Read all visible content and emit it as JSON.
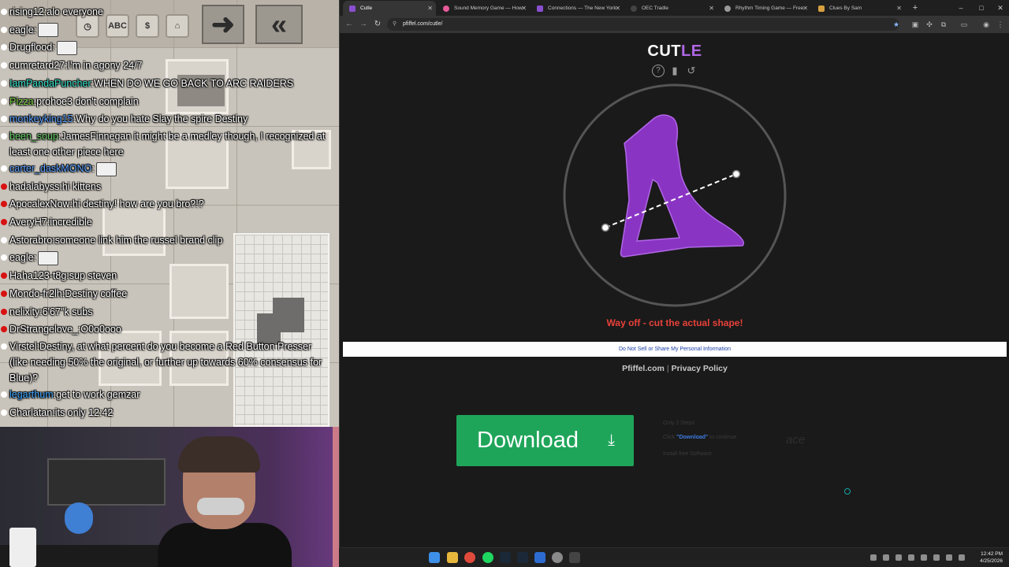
{
  "chat": [
    {
      "user": "rising12",
      "message": "alo everyone",
      "dot": "white",
      "color": "#ffffff"
    },
    {
      "user": "eagle",
      "message": "",
      "dot": "white",
      "color": "#ffffff"
    },
    {
      "user": "Drugflood",
      "message": "",
      "dot": "white",
      "color": "#ffffff"
    },
    {
      "user": "cumretard27",
      "message": "I'm in agony 24/7",
      "dot": "white",
      "color": "#ffffff"
    },
    {
      "user": "IamPandaPuncher",
      "message": "WHEN DO WE GO BACK TO ARC RAIDERS",
      "dot": "white",
      "color": "#35e0c8"
    },
    {
      "user": "Pizza",
      "message": "prohoe3 don't complain",
      "dot": "white",
      "color": "#7fd24a"
    },
    {
      "user": "monkeyking15",
      "message": "Why do you hate Slay the spire Destiny",
      "dot": "white",
      "color": "#5aa0ff"
    },
    {
      "user": "been_soup",
      "message": "JamesFinnegan it might be a medley though, I recognized at least one other piece here",
      "dot": "white",
      "color": "#6ad06a"
    },
    {
      "user": "carter_daskMONO",
      "message": "",
      "dot": "white",
      "color": "#5aa0ff"
    },
    {
      "user": "hadalabyss",
      "message": "hi kittens",
      "dot": "red",
      "color": "#ffffff"
    },
    {
      "user": "ApocalexNow",
      "message": "hi destiny! how are you bro?!?",
      "dot": "red",
      "color": "#ffffff"
    },
    {
      "user": "AveryH7",
      "message": "incredible",
      "dot": "red",
      "color": "#ffffff"
    },
    {
      "user": "Astorabro",
      "message": "someone link him the russel brand clip",
      "dot": "white",
      "color": "#ffffff"
    },
    {
      "user": "eagle",
      "message": "",
      "dot": "white",
      "color": "#ffffff"
    },
    {
      "user": "Haha123-t8g",
      "message": "sup steven",
      "dot": "red",
      "color": "#ffffff"
    },
    {
      "user": "Mondo-fr2lh",
      "message": "Destiny coffee",
      "dot": "red",
      "color": "#ffffff"
    },
    {
      "user": "nelixity",
      "message": "6'67\"k subs",
      "dot": "red",
      "color": "#ffffff"
    },
    {
      "user": "DrStrangelove_",
      "message": "O0o0ooo",
      "dot": "red",
      "color": "#ffffff"
    },
    {
      "user": "Virstel",
      "message": "Destiny, at what percent do you become a Red Button Presser (like needing 50% the original, or further up towards 60% consensus for Blue)?",
      "dot": "white",
      "color": "#ffffff"
    },
    {
      "user": "legarthum",
      "message": "get to work gemzar",
      "dot": "white",
      "color": "#3da4ff"
    },
    {
      "user": "Charlatan",
      "message": "its only 12:42",
      "dot": "white",
      "color": "#ffffff"
    }
  ],
  "game": {
    "tool_labels": [
      "ABC",
      "$"
    ],
    "arrow_labels": [
      "➜",
      "«"
    ]
  },
  "browser": {
    "tabs": [
      {
        "title": "Cutle",
        "active": true,
        "icon_color": "#8a4fd0"
      },
      {
        "title": "Sound Memory Game — How",
        "active": false,
        "icon_color": "#e65a9a"
      },
      {
        "title": "Connections — The New York",
        "active": false,
        "icon_color": "#8a4fd0"
      },
      {
        "title": "OEC Tradle",
        "active": false,
        "icon_color": "#444444"
      },
      {
        "title": "Rhythm Timing Game — Free",
        "active": false,
        "icon_color": "#999999"
      },
      {
        "title": "Clues By Sam",
        "active": false,
        "icon_color": "#d8a040"
      }
    ],
    "new_tab": "+",
    "window_controls": [
      "–",
      "□",
      "✕"
    ],
    "url": "pfiffel.com/cutle/"
  },
  "page": {
    "logo_main": "CUT",
    "logo_accent": "LE",
    "header_icons": [
      "?",
      "▮",
      "↺"
    ],
    "feedback": "Way off - cut the actual shape!",
    "privacy_link": "Do Not Sell or Share My Personal Information",
    "footer_site": "Pfiffel.com",
    "footer_sep": "|",
    "footer_privacy": "Privacy Policy",
    "shape_color": "#8a34c4",
    "accent_color": "#b067e6",
    "feedback_color": "#e8413a"
  },
  "ad": {
    "button_label": "Download",
    "button_icon": "⤓",
    "steps_title": "Only 2 Steps",
    "step1_prefix": "Click",
    "step1_link": "\"Download\"",
    "step1_suffix": "to continue",
    "step2": "Install free Software",
    "brand": "ace"
  },
  "taskbar": {
    "time": "12:42 PM",
    "date": "4/25/2026"
  }
}
